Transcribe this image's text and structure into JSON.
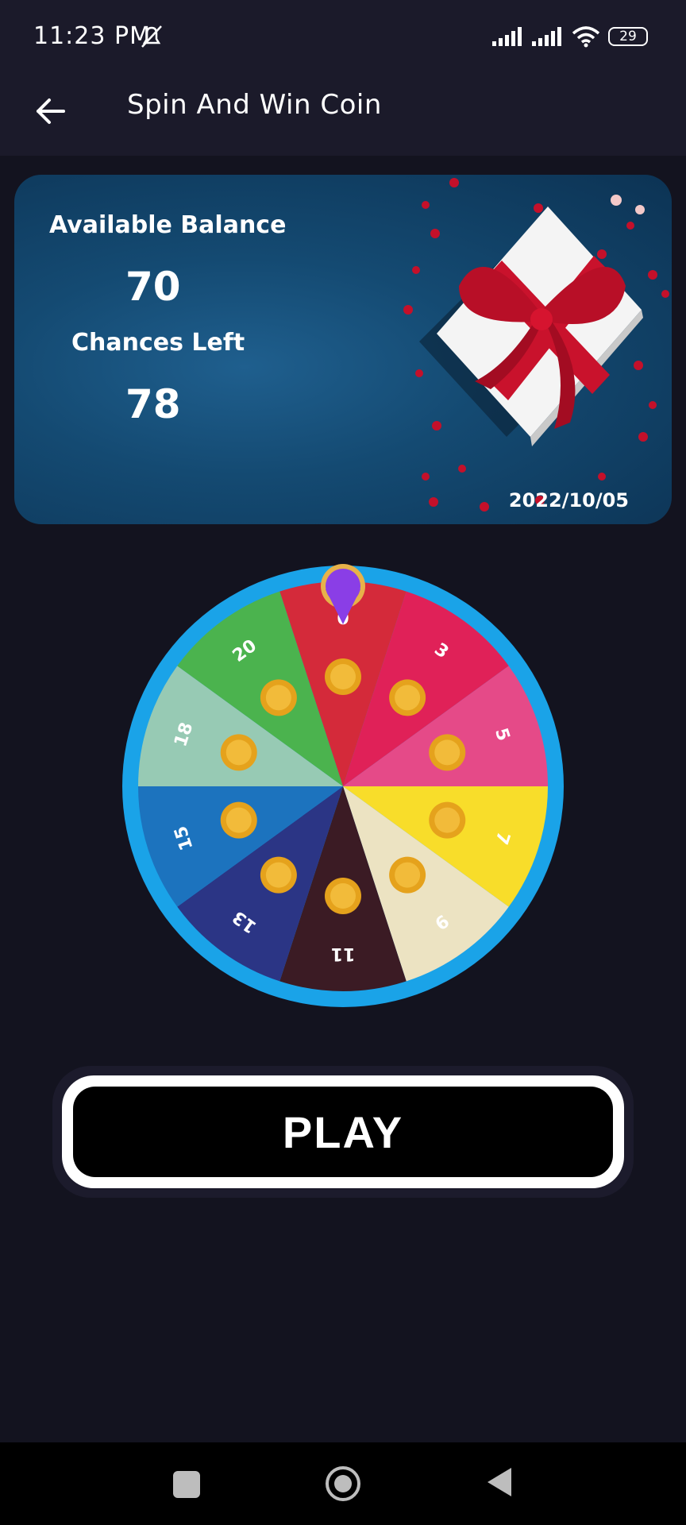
{
  "status_bar": {
    "time": "11:23 PM",
    "battery": "29"
  },
  "app_bar": {
    "title": "Spin And Win Coin"
  },
  "banner": {
    "balance_label": "Available Balance",
    "balance_value": "70",
    "chances_label": "Chances Left",
    "chances_value": "78",
    "date": "2022/10/05"
  },
  "wheel": {
    "segments": [
      {
        "label": "0",
        "color": "#d42a3a"
      },
      {
        "label": "3",
        "color": "#e02158"
      },
      {
        "label": "5",
        "color": "#e54a88"
      },
      {
        "label": "7",
        "color": "#f8dd2a"
      },
      {
        "label": "9",
        "color": "#ece3c2"
      },
      {
        "label": "11",
        "color": "#3b1b24"
      },
      {
        "label": "13",
        "color": "#2b3585"
      },
      {
        "label": "15",
        "color": "#1c73be"
      },
      {
        "label": "18",
        "color": "#97cab4"
      },
      {
        "label": "20",
        "color": "#4bb34e"
      }
    ],
    "rim_color": "#1aa3e8",
    "pointer_color": "#8a3ee6"
  },
  "play_button": {
    "label": "PLAY"
  },
  "colors": {
    "background": "#13131f",
    "bar": "#1b1a2a"
  }
}
